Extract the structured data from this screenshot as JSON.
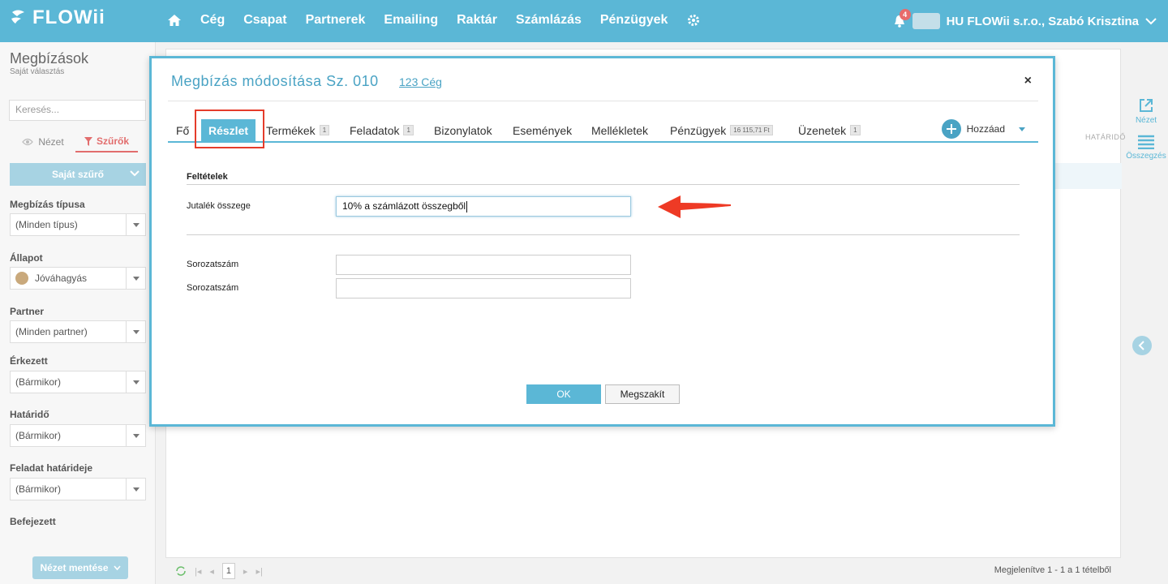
{
  "app": {
    "logo_text": "FLOWii"
  },
  "nav": {
    "items": [
      "Cég",
      "Csapat",
      "Partnerek",
      "Emailing",
      "Raktár",
      "Számlázás",
      "Pénzügyek"
    ],
    "notification_count": "4",
    "user": "HU FLOWii s.r.o., Szabó Krisztina"
  },
  "left": {
    "title": "Megbízások",
    "subtitle": "Saját választás",
    "search_placeholder": "Keresés...",
    "view_label": "Nézet",
    "filter_label": "Szűrők",
    "own_filter": "Saját szűrő",
    "filters": [
      {
        "label": "Megbízás típusa",
        "value": "(Minden típus)"
      },
      {
        "label": "Állapot",
        "value": "Jóváhagyás"
      },
      {
        "label": "Partner",
        "value": "(Minden partner)"
      },
      {
        "label": "Érkezett",
        "value": "(Bármikor)"
      },
      {
        "label": "Határidő",
        "value": "(Bármikor)"
      },
      {
        "label": "Feladat határideje",
        "value": "(Bármikor)"
      },
      {
        "label": "Befejezett",
        "value": ""
      }
    ],
    "save_view": "Nézet mentése"
  },
  "main": {
    "hatarido": "HATÁRIDŐ",
    "right_actions": [
      "Nézet",
      "Összegzés"
    ],
    "status": "Megjelenítve 1 - 1 a 1 tételből",
    "page": "1"
  },
  "modal": {
    "title": "Megbízás módosítása Sz. 010",
    "company_link": "123 Cég",
    "close": "×",
    "tabs": [
      {
        "label": "Fő",
        "count": ""
      },
      {
        "label": "Részlet",
        "count": ""
      },
      {
        "label": "Termékek",
        "count": "1"
      },
      {
        "label": "Feladatok",
        "count": "1"
      },
      {
        "label": "Bizonylatok",
        "count": ""
      },
      {
        "label": "Események",
        "count": ""
      },
      {
        "label": "Mellékletek",
        "count": ""
      },
      {
        "label": "Pénzügyek",
        "count": "16 115,71 Ft"
      },
      {
        "label": "Üzenetek",
        "count": "1"
      }
    ],
    "add_label": "Hozzáad",
    "section_title": "Feltételek",
    "commission_label": "Jutalék összege",
    "commission_value": "10% a számlázott összegből",
    "serial_label_1": "Sorozatszám",
    "serial_label_2": "Sorozatszám",
    "ok": "OK",
    "cancel": "Megszakít"
  },
  "colors": {
    "accent": "#5bb7d6",
    "highlight": "#e53c2b",
    "filter": "#e26d6d"
  }
}
